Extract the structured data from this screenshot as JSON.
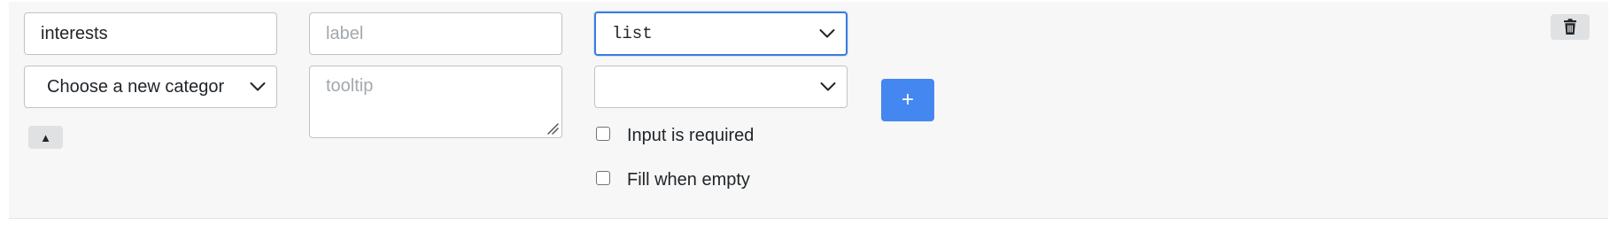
{
  "field": {
    "name_value": "interests",
    "label_placeholder": "label",
    "type_selected": "list",
    "category_selected": "Choose a new categor",
    "tooltip_placeholder": "tooltip",
    "second_select_value": "",
    "required_label": "Input is required",
    "required_checked": false,
    "fill_empty_label": "Fill when empty",
    "fill_empty_checked": false,
    "add_button_label": "+",
    "move_up_label": "▲"
  },
  "icons": {
    "trash": "trash-icon",
    "chevron": "chevron-down-icon",
    "resize": "resize-grip-icon"
  },
  "colors": {
    "accent": "#4587f0",
    "focus_border": "#3d7be0",
    "panel_bg": "#f6f7f6"
  }
}
